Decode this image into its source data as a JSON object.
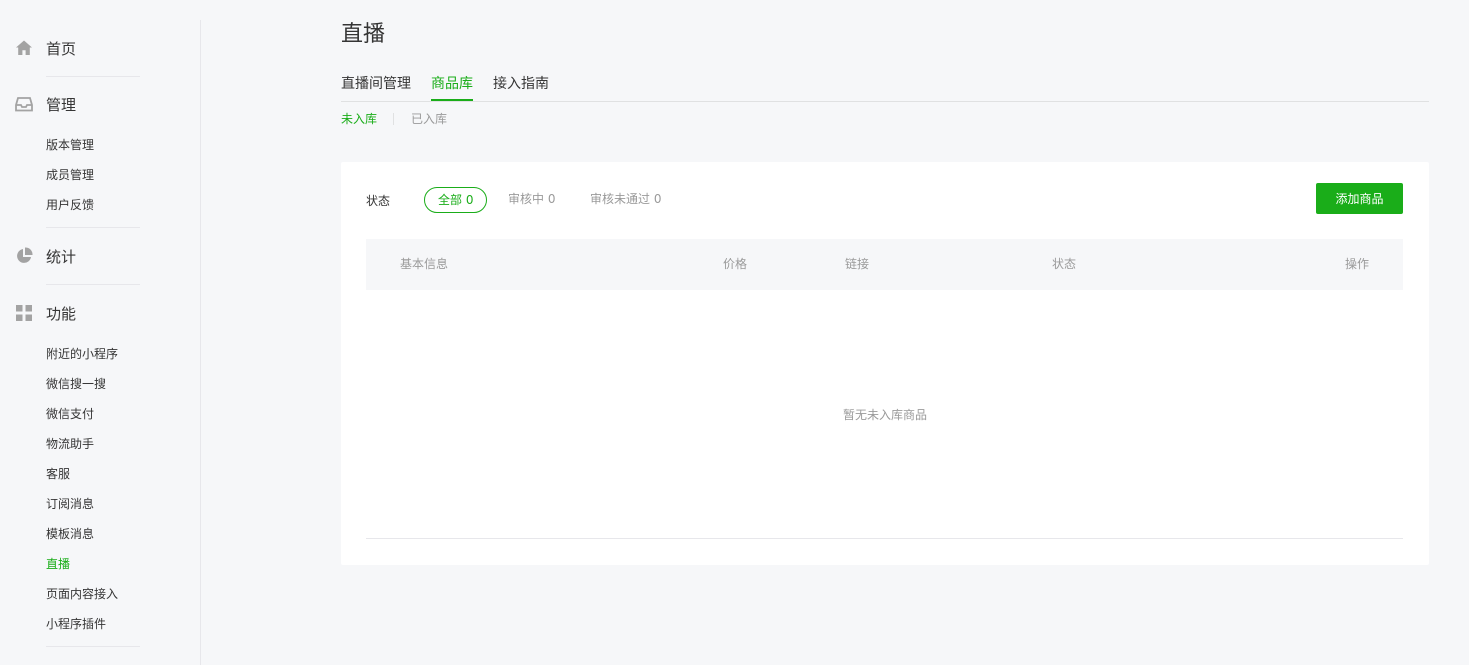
{
  "sidebar": {
    "home": {
      "label": "首页",
      "icon": "home-icon"
    },
    "manage": {
      "label": "管理",
      "icon": "inbox-icon",
      "items": [
        "版本管理",
        "成员管理",
        "用户反馈"
      ]
    },
    "stats": {
      "label": "统计",
      "icon": "pie-chart-icon"
    },
    "features": {
      "label": "功能",
      "icon": "grid-icon",
      "items": [
        "附近的小程序",
        "微信搜一搜",
        "微信支付",
        "物流助手",
        "客服",
        "订阅消息",
        "模板消息",
        "直播",
        "页面内容接入",
        "小程序插件"
      ],
      "active_item": "直播"
    }
  },
  "page": {
    "title": "直播"
  },
  "tabs": [
    "直播间管理",
    "商品库",
    "接入指南"
  ],
  "active_tab": "商品库",
  "subtabs": [
    "未入库",
    "已入库"
  ],
  "active_subtab": "未入库",
  "filter": {
    "label": "状态",
    "options": [
      "全部 0",
      "审核中 0",
      "审核未通过 0"
    ],
    "active": "全部 0"
  },
  "add_button": "添加商品",
  "table": {
    "columns": [
      "基本信息",
      "价格",
      "链接",
      "状态",
      "操作"
    ],
    "empty_text": "暂无未入库商品"
  },
  "colors": {
    "accent": "#1aad19",
    "background": "#f6f7f9",
    "text": "#353535",
    "muted": "#9a9a9a"
  }
}
